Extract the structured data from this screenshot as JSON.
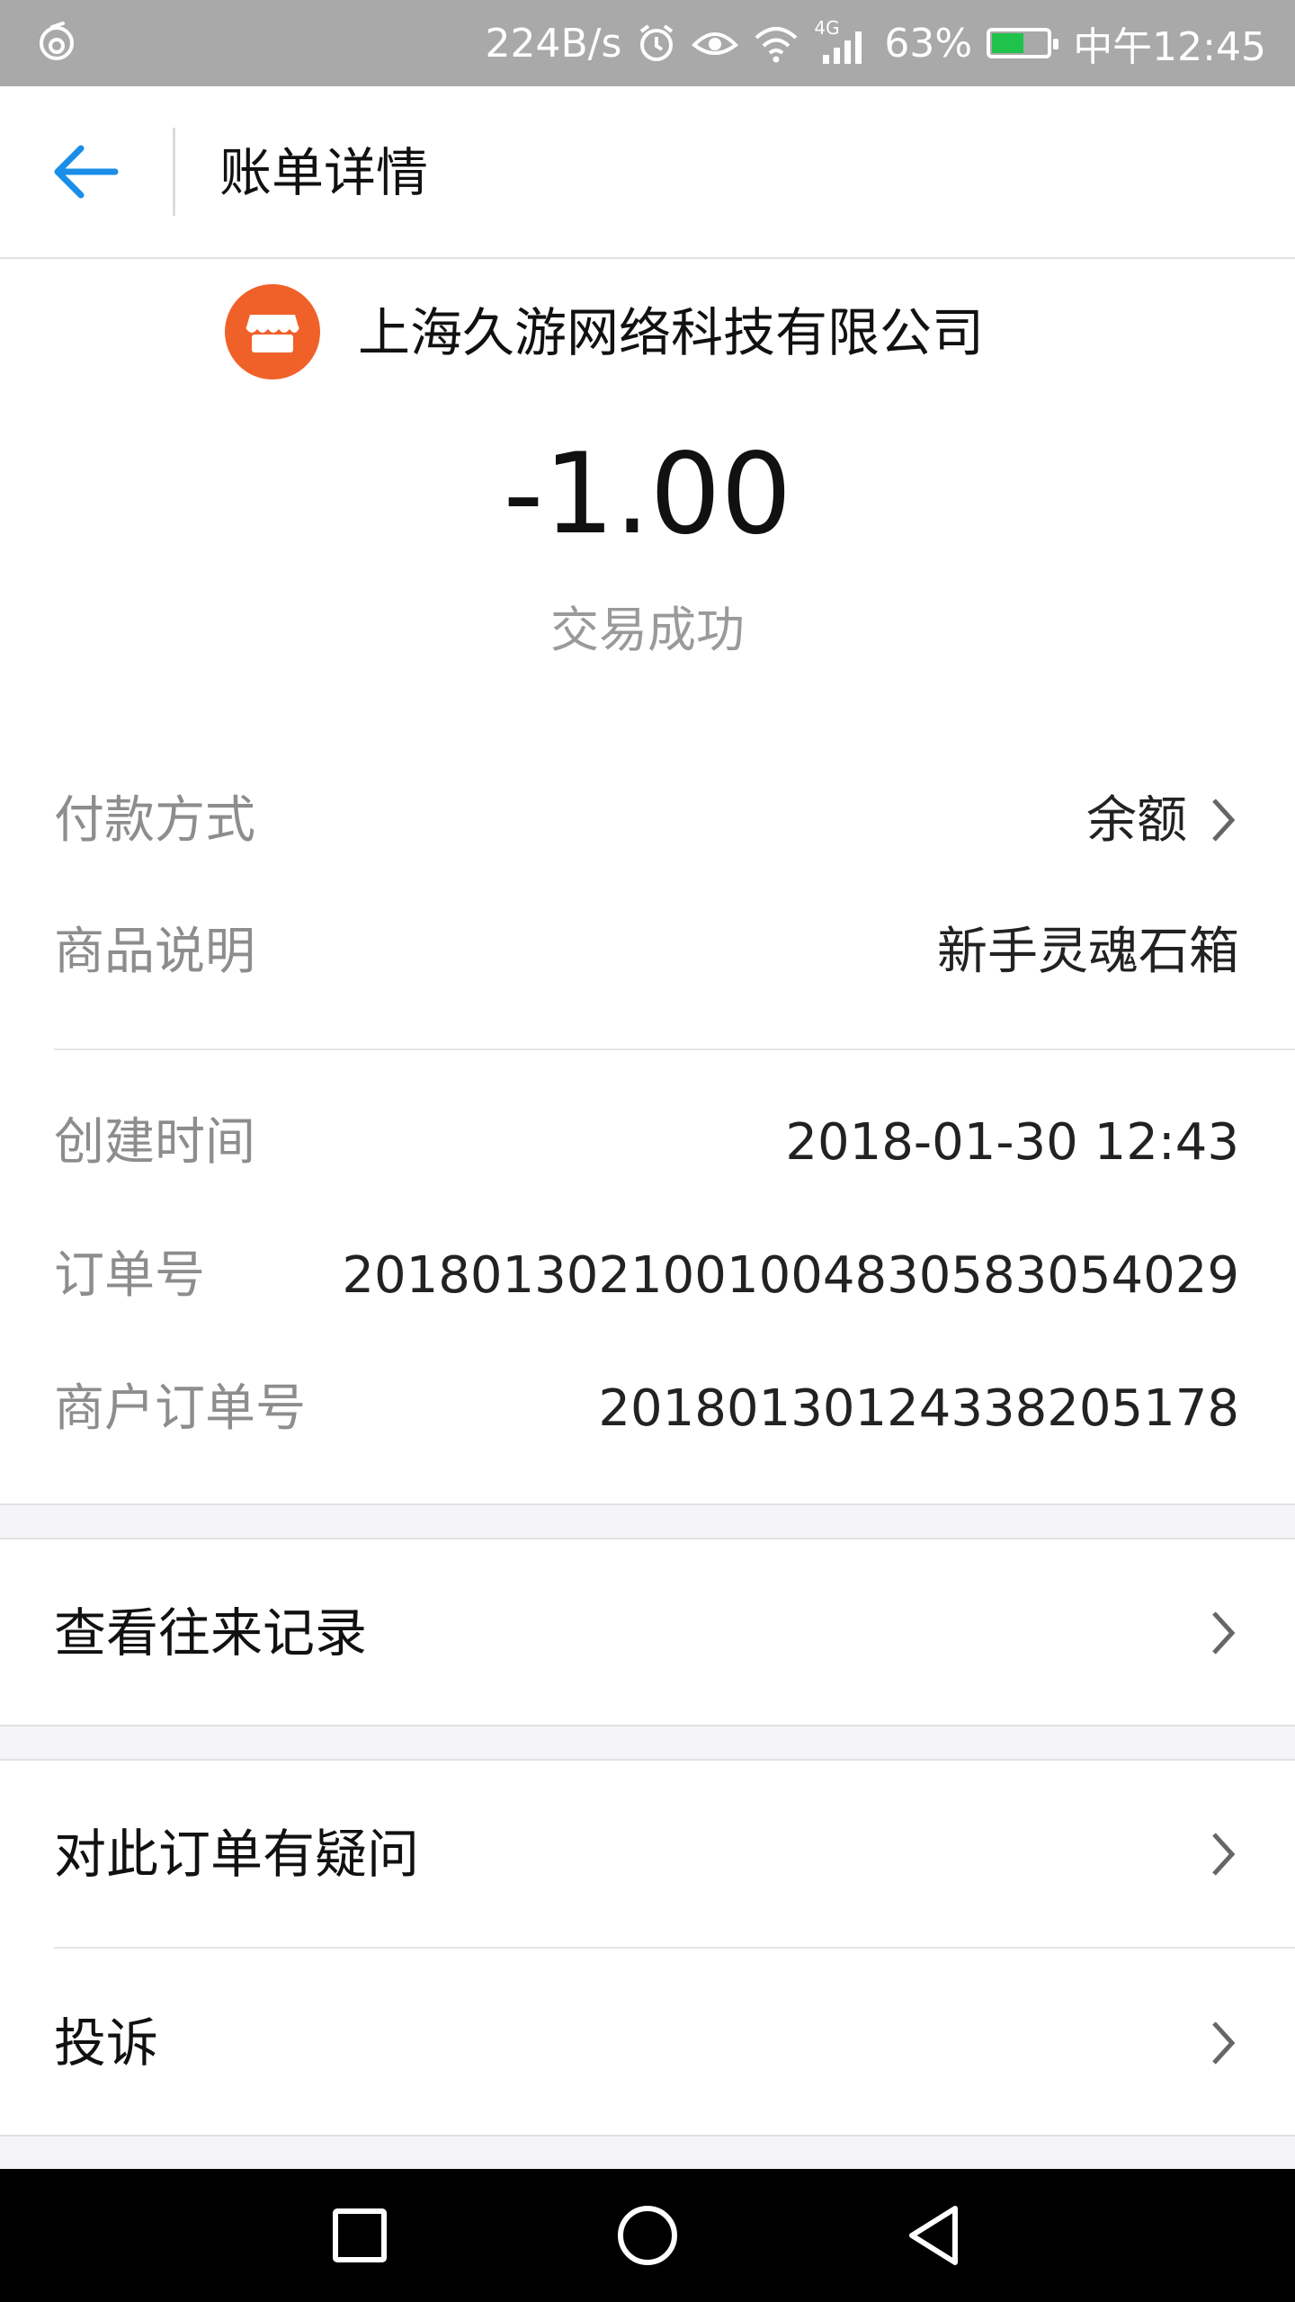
{
  "status_bar": {
    "net_speed": "224B/s",
    "signal_type": "4G",
    "battery_percent": "63%",
    "battery_level": 0.63,
    "time": "中午12:45",
    "icons": [
      "weibo-icon",
      "alarm-icon",
      "eye-icon",
      "wifi-icon",
      "signal-icon",
      "battery-icon"
    ]
  },
  "header": {
    "title": "账单详情"
  },
  "merchant": {
    "name": "上海久游网络科技有限公司",
    "icon": "store-icon",
    "icon_color": "#f0612a"
  },
  "amount": "-1.00",
  "trade_status": "交易成功",
  "details": [
    {
      "label": "付款方式",
      "value": "余额",
      "has_chevron": true
    },
    {
      "label": "商品说明",
      "value": "新手灵魂石箱",
      "has_chevron": false
    }
  ],
  "details2": [
    {
      "label": "创建时间",
      "value": "2018-01-30 12:43"
    },
    {
      "label": "订单号",
      "value": "2018013021001004830583054029"
    },
    {
      "label": "商户订单号",
      "value": "20180130124338205178"
    }
  ],
  "actions": {
    "history": "查看往来记录",
    "question": "对此订单有疑问",
    "complaint": "投诉"
  },
  "navbar": {
    "icons": [
      "recent-apps-icon",
      "home-icon",
      "back-triangle-icon"
    ]
  },
  "colors": {
    "accent": "#1a8ee8",
    "status_bar_bg": "#a9a9a9",
    "merchant_orange": "#f0612a"
  }
}
